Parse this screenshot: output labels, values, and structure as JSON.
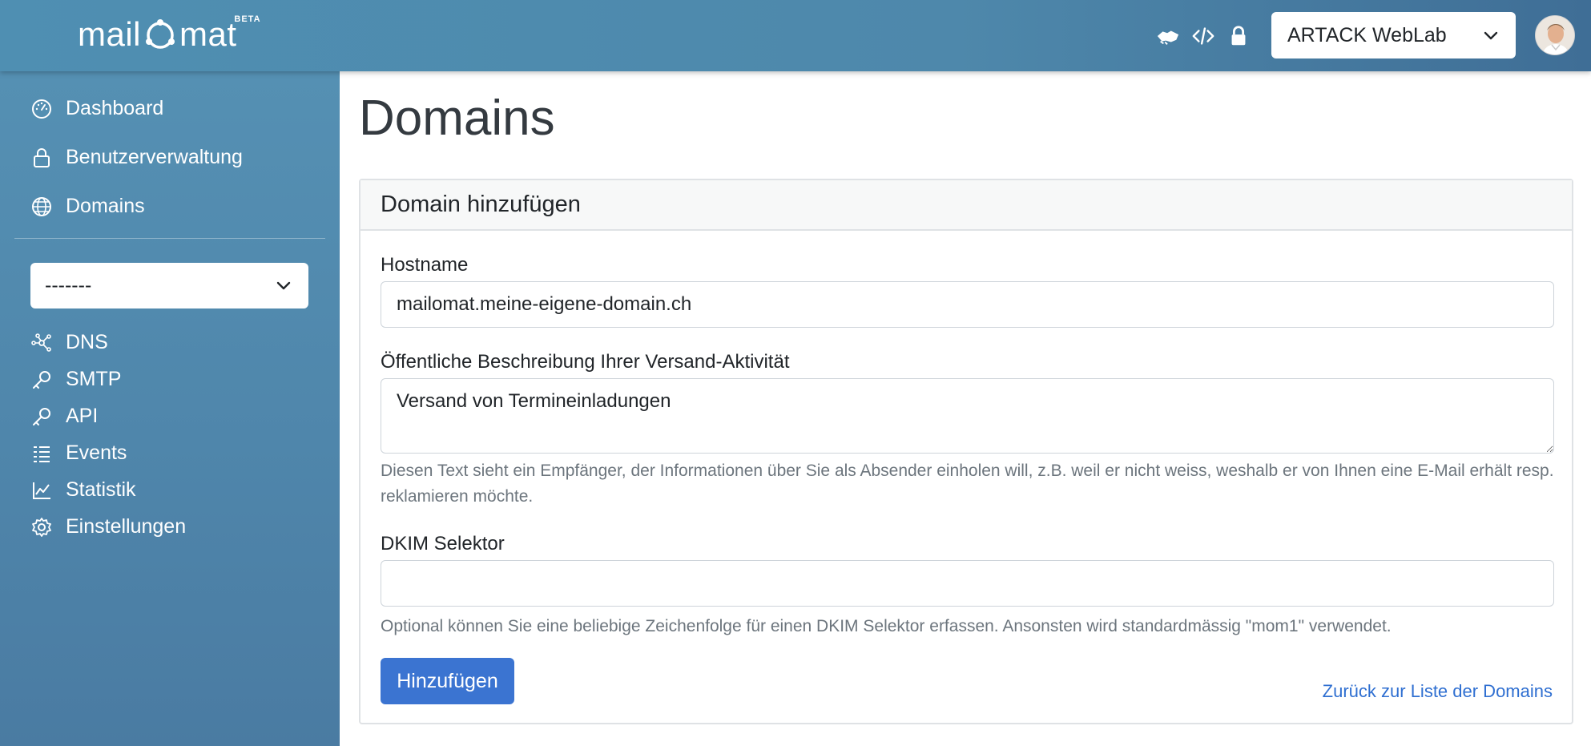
{
  "header": {
    "logo_text_left": "mail",
    "logo_text_right": "mat",
    "logo_badge": "BETA",
    "icons": [
      "handshake-icon",
      "code-icon",
      "lock-icon"
    ],
    "org_select_value": "ARTACK WebLab"
  },
  "sidebar": {
    "main_items": [
      {
        "label": "Dashboard",
        "icon": "dashboard-icon"
      },
      {
        "label": "Benutzerverwaltung",
        "icon": "lock-icon"
      },
      {
        "label": "Domains",
        "icon": "globe-icon"
      }
    ],
    "domain_select_value": "-------",
    "domain_items": [
      {
        "label": "DNS",
        "icon": "network-icon"
      },
      {
        "label": "SMTP",
        "icon": "key-icon"
      },
      {
        "label": "API",
        "icon": "key-icon"
      },
      {
        "label": "Events",
        "icon": "list-icon"
      },
      {
        "label": "Statistik",
        "icon": "chart-line-icon"
      },
      {
        "label": "Einstellungen",
        "icon": "gear-icon"
      }
    ]
  },
  "main": {
    "page_title": "Domains",
    "card_title": "Domain hinzufügen",
    "hostname_label": "Hostname",
    "hostname_value": "mailomat.meine-eigene-domain.ch",
    "description_label": "Öffentliche Beschreibung Ihrer Versand-Aktivität",
    "description_value": "Versand von Termineinladungen",
    "description_help": "Diesen Text sieht ein Empfänger, der Informationen über Sie als Absender einholen will, z.B. weil er nicht weiss, weshalb er von Ihnen eine E-Mail erhält resp. reklamieren möchte.",
    "dkim_label": "DKIM Selektor",
    "dkim_value": "",
    "dkim_help": "Optional können Sie eine beliebige Zeichenfolge für einen DKIM Selektor erfassen. Ansonsten wird standardmässig \"mom1\" verwendet.",
    "submit_label": "Hinzufügen",
    "back_link": "Zurück zur Liste der Domains"
  },
  "colors": {
    "accent": "#3b74d1",
    "sidebar": "#4f86ab",
    "header": "#4e88ab"
  }
}
